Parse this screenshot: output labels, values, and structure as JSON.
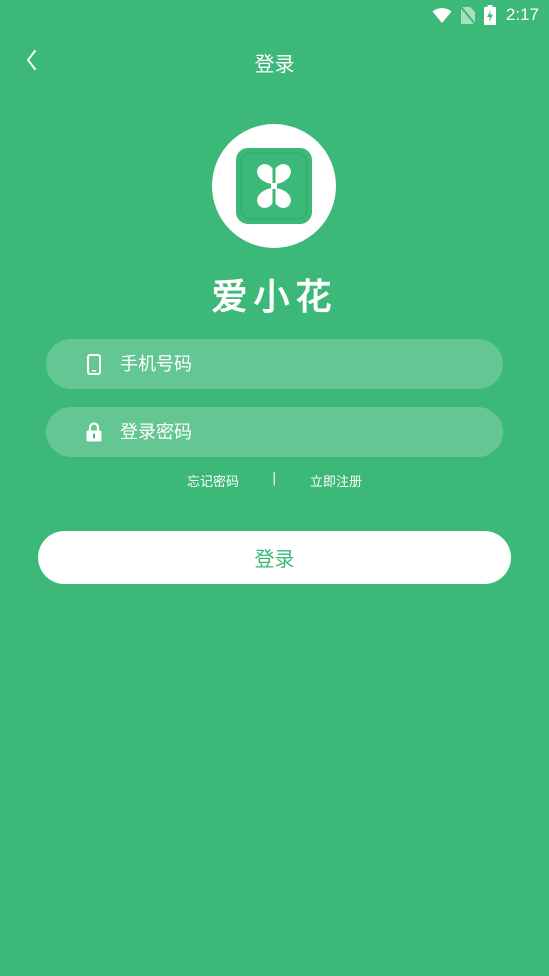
{
  "status_bar": {
    "time": "2:17",
    "icons": [
      "wifi-icon",
      "no-sim-icon",
      "battery-charging-icon"
    ]
  },
  "nav": {
    "title": "登录",
    "back_icon": "chevron-left-icon"
  },
  "app": {
    "name": "爱小花",
    "logo_icon": "four-leaf-clover-icon"
  },
  "form": {
    "phone": {
      "placeholder": "手机号码",
      "value": "",
      "icon": "phone-icon"
    },
    "password": {
      "placeholder": "登录密码",
      "value": "",
      "icon": "lock-icon"
    }
  },
  "links": {
    "forgot_password": "忘记密码",
    "divider": "|",
    "register": "立即注册"
  },
  "login_button": {
    "label": "登录"
  },
  "colors": {
    "background": "#3cb878",
    "accent": "#3cb878",
    "button_bg": "#ffffff",
    "text": "#ffffff"
  }
}
